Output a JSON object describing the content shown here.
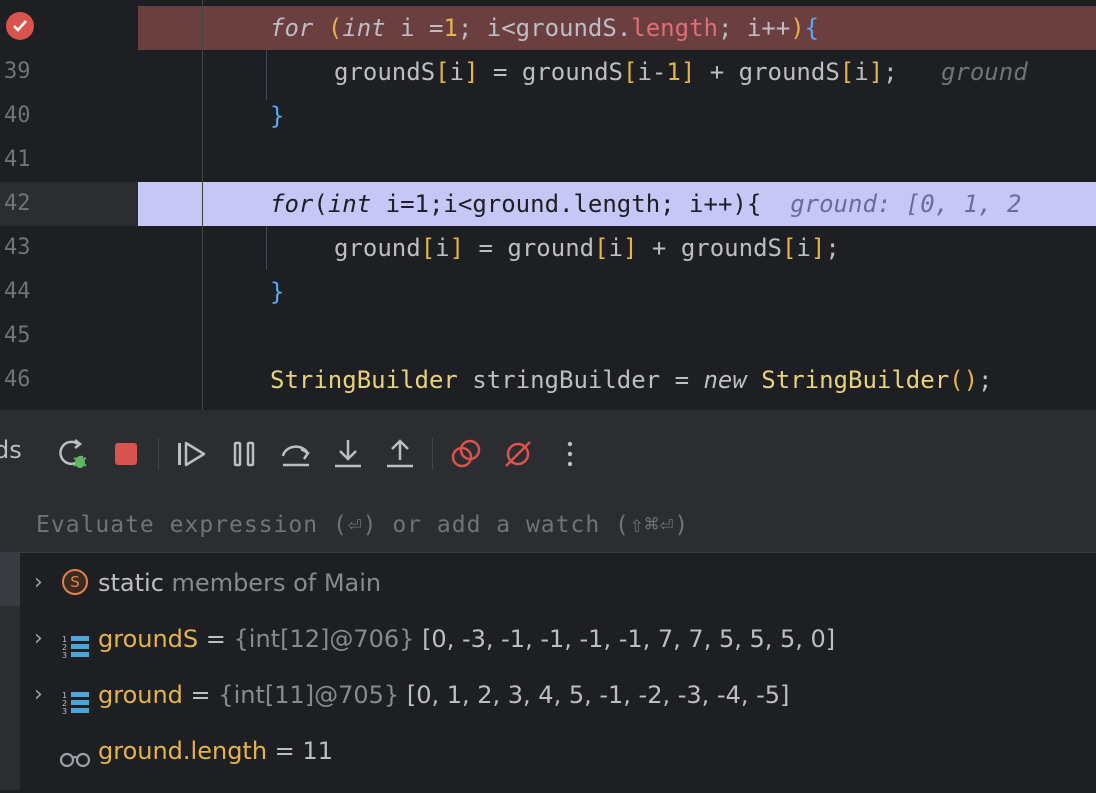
{
  "editor": {
    "lines": [
      {
        "num": "",
        "tokens": [
          {
            "t": "for",
            "c": "kwi"
          },
          {
            "t": " ",
            "c": ""
          },
          {
            "t": "(",
            "c": "br-y"
          },
          {
            "t": "int",
            "c": "kwi"
          },
          {
            "t": " i =",
            "c": ""
          },
          {
            "t": "1",
            "c": "num-y"
          },
          {
            "t": "; i<groundS.",
            "c": ""
          },
          {
            "t": "length",
            "c": "fld"
          },
          {
            "t": "; i++",
            "c": ""
          },
          {
            "t": ")",
            "c": "br-y"
          },
          {
            "t": "{",
            "c": "br-b"
          }
        ]
      },
      {
        "num": "39",
        "tokens": [
          {
            "t": "groundS",
            "c": ""
          },
          {
            "t": "[",
            "c": "br-y"
          },
          {
            "t": "i",
            "c": ""
          },
          {
            "t": "]",
            "c": "br-y"
          },
          {
            "t": " = groundS",
            "c": ""
          },
          {
            "t": "[",
            "c": "br-y"
          },
          {
            "t": "i-",
            "c": ""
          },
          {
            "t": "1",
            "c": "num-y"
          },
          {
            "t": "]",
            "c": "br-y"
          },
          {
            "t": " + groundS",
            "c": ""
          },
          {
            "t": "[",
            "c": "br-y"
          },
          {
            "t": "i",
            "c": ""
          },
          {
            "t": "]",
            "c": "br-y"
          },
          {
            "t": ";",
            "c": ""
          },
          {
            "t": "   ground",
            "c": "dim"
          }
        ]
      },
      {
        "num": "40",
        "tokens": [
          {
            "t": "}",
            "c": "br-b"
          }
        ]
      },
      {
        "num": "41",
        "tokens": []
      },
      {
        "num": "42",
        "tokens": [
          {
            "t": "for",
            "c": "kwi"
          },
          {
            "t": "(",
            "c": ""
          },
          {
            "t": "int",
            "c": "kwi"
          },
          {
            "t": " i=1;i<ground.length; i++){",
            "c": ""
          },
          {
            "t": "  ground: [0, 1, 2",
            "c": "dim"
          }
        ]
      },
      {
        "num": "43",
        "tokens": [
          {
            "t": "ground",
            "c": ""
          },
          {
            "t": "[",
            "c": "br-y"
          },
          {
            "t": "i",
            "c": ""
          },
          {
            "t": "]",
            "c": "br-y"
          },
          {
            "t": " = ground",
            "c": ""
          },
          {
            "t": "[",
            "c": "br-y"
          },
          {
            "t": "i",
            "c": ""
          },
          {
            "t": "]",
            "c": "br-y"
          },
          {
            "t": " + groundS",
            "c": ""
          },
          {
            "t": "[",
            "c": "br-y"
          },
          {
            "t": "i",
            "c": ""
          },
          {
            "t": "]",
            "c": "br-y"
          },
          {
            "t": ";",
            "c": ""
          }
        ]
      },
      {
        "num": "44",
        "tokens": [
          {
            "t": "}",
            "c": "br-b"
          }
        ]
      },
      {
        "num": "45",
        "tokens": []
      },
      {
        "num": "46",
        "tokens": [
          {
            "t": "StringBuilder",
            "c": "cls"
          },
          {
            "t": " stringBuilder = ",
            "c": ""
          },
          {
            "t": "new",
            "c": "kwi"
          },
          {
            "t": " ",
            "c": ""
          },
          {
            "t": "StringBuilder",
            "c": "cls"
          },
          {
            "t": "()",
            "c": "br-y"
          },
          {
            "t": ";",
            "c": ""
          }
        ]
      }
    ]
  },
  "toolbar": {
    "left_label": "ds",
    "buttons": [
      "rerun-debug-icon",
      "stop-icon",
      "resume-icon",
      "pause-icon",
      "step-over-icon",
      "step-into-icon",
      "step-out-icon",
      "view-breakpoints-icon",
      "mute-breakpoints-icon",
      "more-icon"
    ]
  },
  "debugger": {
    "eval_placeholder": "Evaluate expression (⏎) or add a watch (⇧⌘⏎)",
    "variables": [
      {
        "icon": "static-icon",
        "badge": "S",
        "name": "static",
        "rest": "members of Main",
        "expandable": true
      },
      {
        "icon": "array-icon",
        "name": "groundS",
        "eq": " = ",
        "type": "{int[12]@706}",
        "value": " [0, -3, -1, -1, -1, -1, 7, 7, 5, 5, 5, 0]",
        "expandable": true
      },
      {
        "icon": "array-icon",
        "name": "ground",
        "eq": " = ",
        "type": "{int[11]@705}",
        "value": " [0, 1, 2, 3, 4, 5, -1, -2, -3, -4, -5]",
        "expandable": true
      },
      {
        "icon": "watch-icon",
        "name": "ground.length",
        "eq": " = ",
        "value": "11",
        "expandable": false
      }
    ]
  }
}
